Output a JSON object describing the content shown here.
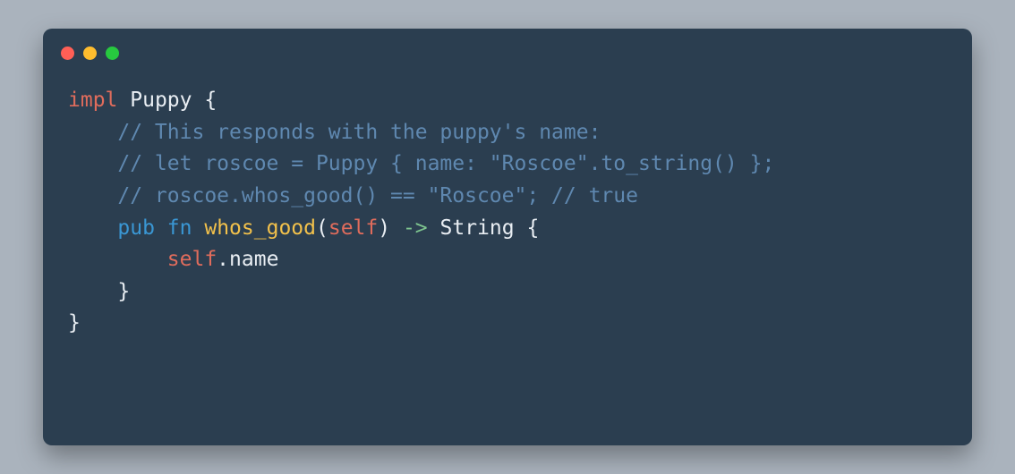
{
  "colors": {
    "background": "#aab3bd",
    "panel": "#2b3e50",
    "dot_red": "#ff5f56",
    "dot_yellow": "#ffbd2e",
    "dot_green": "#27c93f",
    "kw_impl_self": "#e06c5c",
    "kw_pub_fn": "#3a97d4",
    "fn_name": "#f2c14b",
    "comment": "#5f88b0",
    "arrow": "#7ec48f",
    "default": "#e9eef3"
  },
  "code": {
    "line1": {
      "impl": "impl",
      "sp1": " ",
      "type": "Puppy",
      "sp2": " ",
      "brace": "{"
    },
    "line2": {
      "indent": "    ",
      "text": "// This responds with the puppy's name:"
    },
    "line3": {
      "indent": "    ",
      "text": "// let roscoe = Puppy { name: \"Roscoe\".to_string() };"
    },
    "line4": {
      "indent": "    ",
      "text": "// roscoe.whos_good() == \"Roscoe\"; // true"
    },
    "line5": {
      "indent": "    ",
      "pub": "pub",
      "sp1": " ",
      "fn": "fn",
      "sp2": " ",
      "name": "whos_good",
      "paren_o": "(",
      "self": "self",
      "paren_c": ")",
      "sp3": " ",
      "arrow": "->",
      "sp4": " ",
      "ret": "String",
      "sp5": " ",
      "brace": "{"
    },
    "line6": {
      "indent": "        ",
      "self": "self",
      "dot": ".",
      "field": "name"
    },
    "line7": {
      "indent": "    ",
      "brace": "}"
    },
    "line8": {
      "brace": "}"
    }
  }
}
